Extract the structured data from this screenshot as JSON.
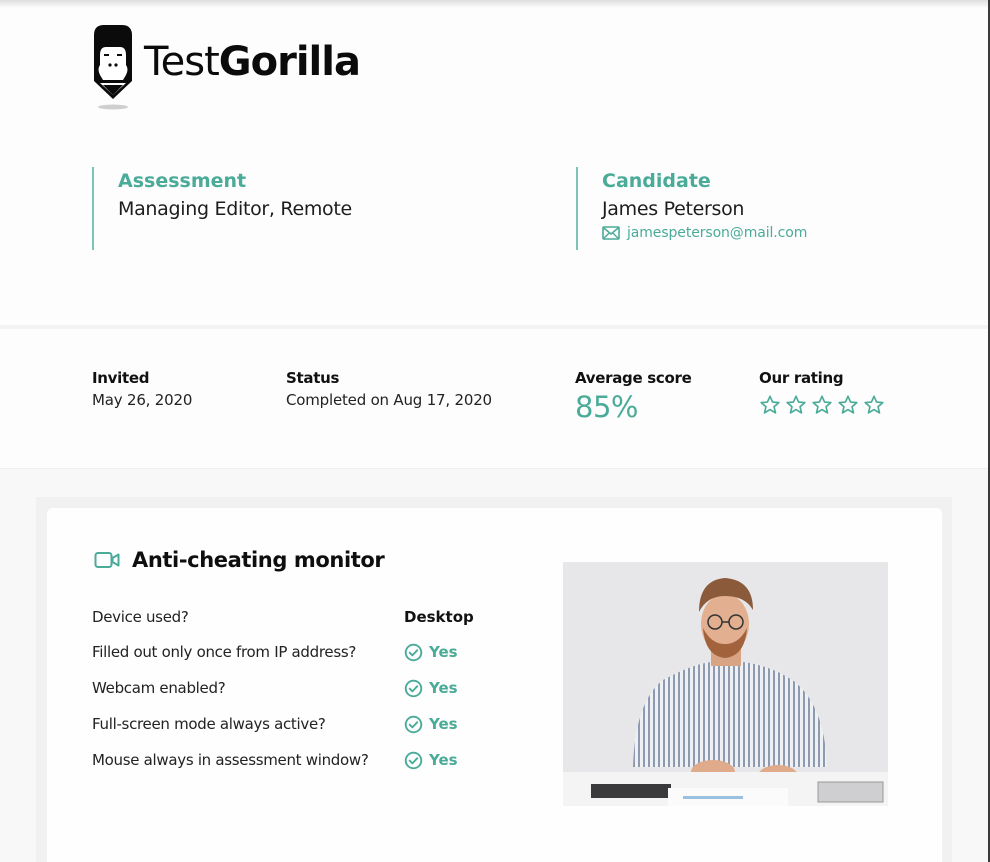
{
  "brand": {
    "name_light": "Test",
    "name_bold": "Gorilla",
    "accent_color": "#4aab98"
  },
  "assessment": {
    "label": "Assessment",
    "value": "Managing Editor, Remote"
  },
  "candidate": {
    "label": "Candidate",
    "name": "James Peterson",
    "email_icon": "envelope-icon",
    "email": "jamespeterson@mail.com"
  },
  "stats": {
    "invited": {
      "label": "Invited",
      "value": "May 26, 2020"
    },
    "status": {
      "label": "Status",
      "value": "Completed on Aug 17, 2020"
    },
    "average_score": {
      "label": "Average score",
      "value": "85%"
    },
    "rating": {
      "label": "Our rating",
      "stars_filled": 0,
      "stars_total": 5
    }
  },
  "anti_cheating": {
    "icon": "video-camera-icon",
    "title": "Anti-cheating monitor",
    "rows": [
      {
        "question": "Device used?",
        "answer": "Desktop",
        "check": false
      },
      {
        "question": "Filled out only once from IP address?",
        "answer": "Yes",
        "check": true
      },
      {
        "question": "Webcam enabled?",
        "answer": "Yes",
        "check": true
      },
      {
        "question": "Full-screen mode always active?",
        "answer": "Yes",
        "check": true
      },
      {
        "question": "Mouse always in assessment window?",
        "answer": "Yes",
        "check": true
      }
    ],
    "photo_alt": "Webcam snapshot of candidate at desk"
  }
}
